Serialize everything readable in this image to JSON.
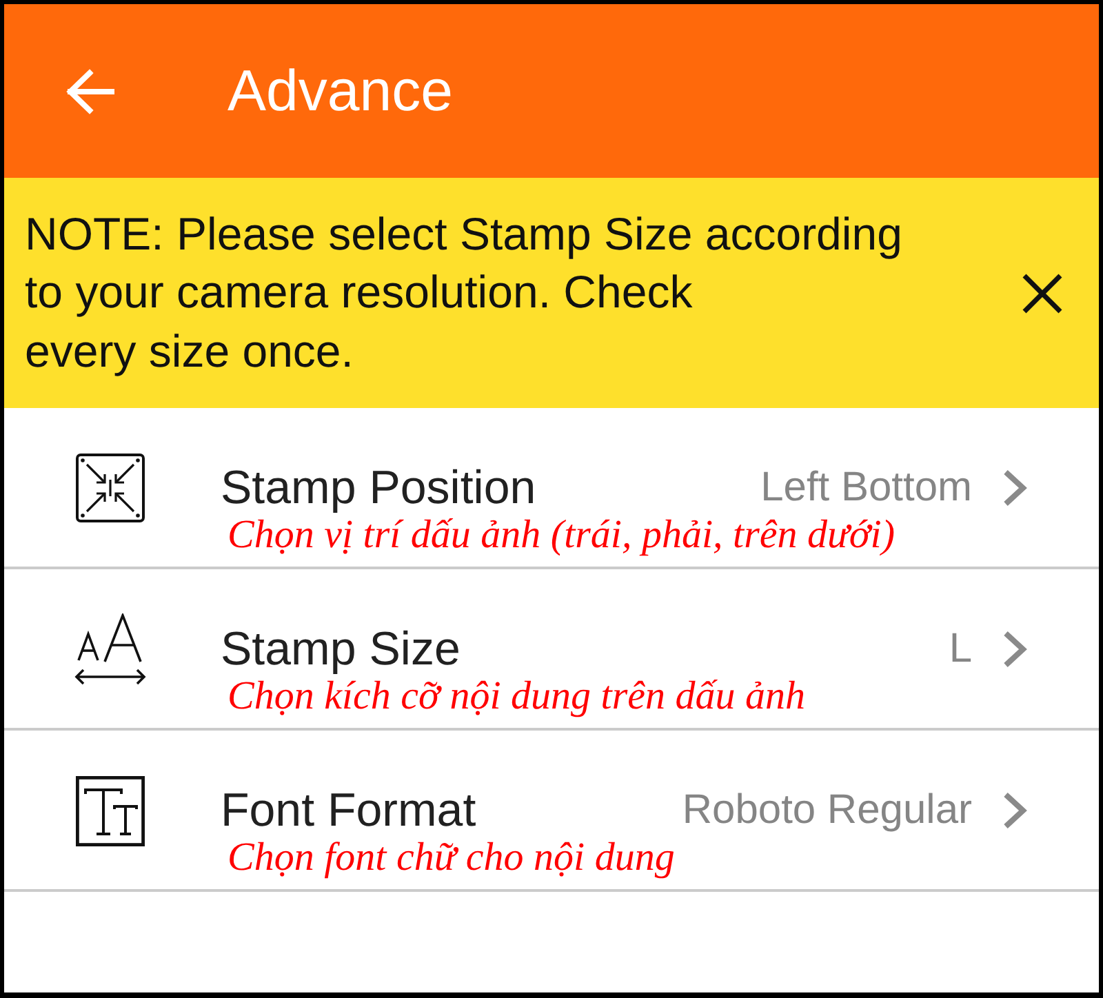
{
  "app_bar": {
    "title": "Advance"
  },
  "note": {
    "text": "NOTE: Please select Stamp Size according\nto your camera resolution. Check\nevery size once."
  },
  "settings": [
    {
      "kind": "position",
      "title": "Stamp Position",
      "value": "Left Bottom",
      "annotation": "Chọn vị trí dấu ảnh (trái, phải, trên dưới)"
    },
    {
      "kind": "size",
      "title": "Stamp Size",
      "value": "L",
      "annotation": "Chọn kích cỡ nội dung trên dấu ảnh"
    },
    {
      "kind": "font",
      "title": "Font Format",
      "value": "Roboto Regular",
      "annotation": "Chọn font chữ cho nội dung"
    }
  ]
}
